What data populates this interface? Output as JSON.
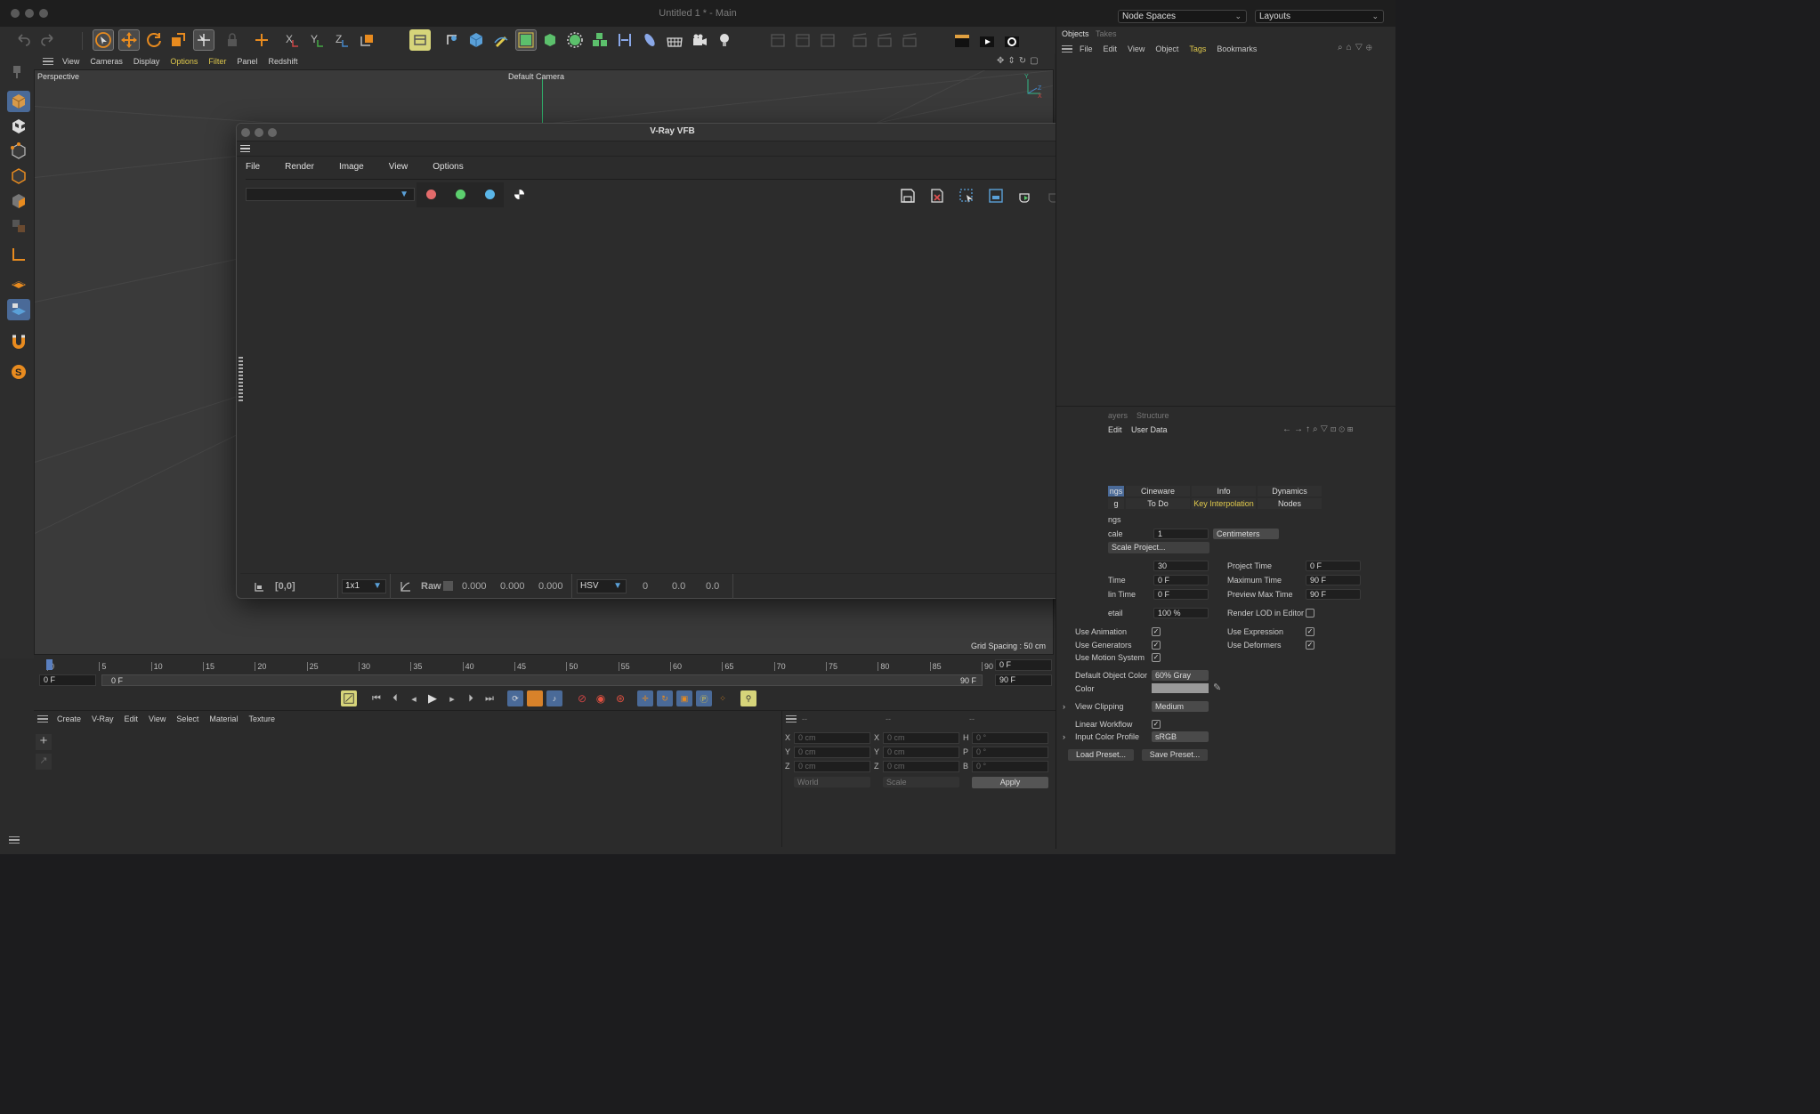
{
  "window": {
    "title": "Untitled 1 * - Main"
  },
  "top_selectors": {
    "node_spaces": "Node Spaces",
    "layouts": "Layouts"
  },
  "viewport_menu": [
    "View",
    "Cameras",
    "Display",
    "Options",
    "Filter",
    "Panel",
    "Redshift"
  ],
  "viewport": {
    "label": "Perspective",
    "camera": "Default Camera",
    "grid_spacing": "Grid Spacing : 50 cm"
  },
  "objects_panel": {
    "tabs": [
      "Objects",
      "Takes"
    ],
    "menu": [
      "File",
      "Edit",
      "View",
      "Object",
      "Tags",
      "Bookmarks"
    ]
  },
  "attributes": {
    "tabs": [
      "ayers",
      "Structure"
    ],
    "menu": [
      "Edit",
      "User Data"
    ],
    "subtabs_row1": [
      "ngs",
      "Cineware",
      "Info",
      "Dynamics"
    ],
    "subtabs_row2": [
      "g",
      "To Do",
      "Key Interpolation",
      "Nodes"
    ],
    "section": "ngs",
    "scale_label": "cale",
    "scale_value": "1",
    "scale_unit": "Centimeters",
    "scale_project": "Scale Project...",
    "fps_value": "30",
    "project_time_label": "Project Time",
    "project_time": "0 F",
    "time_label": "Time",
    "time_value": "0 F",
    "max_time_label": "Maximum Time",
    "max_time": "90 F",
    "min_time_label": "lin Time",
    "min_time": "0 F",
    "preview_max_label": "Preview Max Time",
    "preview_max": "90 F",
    "detail_label": "etail",
    "detail_value": "100 %",
    "render_lod_label": "Render LOD in Editor",
    "use_animation": "Use Animation",
    "use_expression": "Use Expression",
    "use_generators": "Use Generators",
    "use_deformers": "Use Deformers",
    "use_motion": "Use Motion System",
    "default_color_label": "Default Object Color",
    "default_color": "60% Gray",
    "color_label": "Color",
    "view_clipping_label": "View Clipping",
    "view_clipping": "Medium",
    "linear_workflow": "Linear Workflow",
    "input_profile_label": "Input Color Profile",
    "input_profile": "sRGB",
    "load_preset": "Load Preset...",
    "save_preset": "Save Preset..."
  },
  "vfb": {
    "title": "V-Ray VFB",
    "menu": [
      "File",
      "Render",
      "Image",
      "View",
      "Options"
    ],
    "coords": "[0,0]",
    "zoom": "1x1",
    "raw_label": "Raw",
    "raw_values": [
      "0.000",
      "0.000",
      "0.000"
    ],
    "color_mode": "HSV",
    "hsv_values": [
      "0",
      "0.0",
      "0.0"
    ]
  },
  "timeline": {
    "ticks": [
      "0",
      "5",
      "10",
      "15",
      "20",
      "25",
      "30",
      "35",
      "40",
      "45",
      "50",
      "55",
      "60",
      "65",
      "70",
      "75",
      "80",
      "85",
      "90"
    ],
    "end_frame": "0 F",
    "start_field": "0 F",
    "range_start": "0 F",
    "range_end": "90 F",
    "max_field": "90 F"
  },
  "material_menu": [
    "Create",
    "V-Ray",
    "Edit",
    "View",
    "Select",
    "Material",
    "Texture"
  ],
  "coords_panel": {
    "headers": [
      "--",
      "--",
      "--"
    ],
    "rows": [
      {
        "a": "X",
        "av": "0 cm",
        "b": "X",
        "bv": "0 cm",
        "c": "H",
        "cv": "0 °"
      },
      {
        "a": "Y",
        "av": "0 cm",
        "b": "Y",
        "bv": "0 cm",
        "c": "P",
        "cv": "0 °"
      },
      {
        "a": "Z",
        "av": "0 cm",
        "b": "Z",
        "bv": "0 cm",
        "c": "B",
        "cv": "0 °"
      }
    ],
    "world": "World",
    "scale": "Scale",
    "apply": "Apply"
  }
}
